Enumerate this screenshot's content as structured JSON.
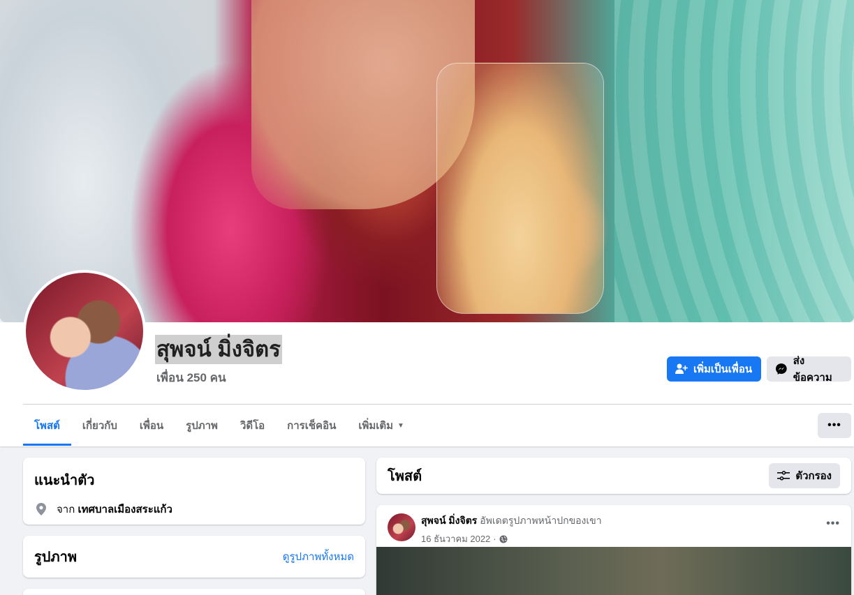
{
  "profile": {
    "name": "สุพจน์ มิ่งจิตร",
    "friends": "เพื่อน 250 คน",
    "add_friend_label": "เพิ่มเป็นเพื่อน",
    "message_label": "ส่งข้อความ"
  },
  "tabs": [
    {
      "label": "โพสต์",
      "active": true
    },
    {
      "label": "เกี่ยวกับ"
    },
    {
      "label": "เพื่อน"
    },
    {
      "label": "รูปภาพ"
    },
    {
      "label": "วิดีโอ"
    },
    {
      "label": "การเช็คอิน"
    },
    {
      "label": "เพิ่มเติม"
    }
  ],
  "more_button": "•••",
  "intro": {
    "title": "แนะนำตัว",
    "from_prefix": "จาก",
    "location": "เทศบาลเมืองสระแก้ว"
  },
  "photos": {
    "title": "รูปภาพ",
    "see_all": "ดูรูปภาพทั้งหมด"
  },
  "posts": {
    "title": "โพสต์",
    "filter_label": "ตัวกรอง"
  },
  "post": {
    "author": "สุพจน์ มิ่งจิตร",
    "action": "อัพเดตรูปภาพหน้าปกของเขา",
    "date": "16 ธันวาคม 2022",
    "separator": "·",
    "menu": "•••"
  },
  "colors": {
    "accent": "#1877f2",
    "background": "#f0f2f5",
    "secondary_button": "#e4e6eb"
  }
}
